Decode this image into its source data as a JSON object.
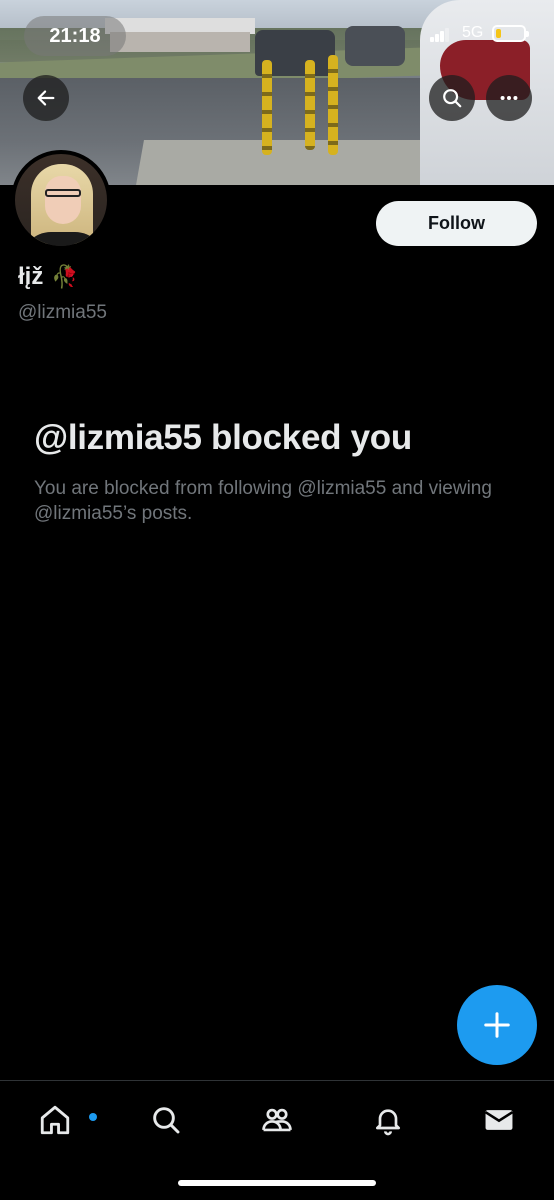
{
  "status_bar": {
    "time": "21:18",
    "network": "5G",
    "battery_level": 0.2,
    "battery_color": "#f5c518"
  },
  "header": {
    "back_icon": "arrow-left-icon",
    "search_icon": "search-icon",
    "more_icon": "more-horizontal-icon"
  },
  "profile": {
    "display_name": "łįž",
    "name_emoji": "🥀",
    "handle": "@lizmia55",
    "follow_label": "Follow"
  },
  "blocked": {
    "title": "@lizmia55 blocked you",
    "description": "You are blocked from following @lizmia55 and viewing @lizmia55’s posts."
  },
  "fab": {
    "icon": "plus-icon",
    "color": "#1d9bf0"
  },
  "tabbar": {
    "items": [
      {
        "icon": "home-icon",
        "has_notification_dot": true
      },
      {
        "icon": "search-icon"
      },
      {
        "icon": "communities-icon"
      },
      {
        "icon": "bell-icon"
      },
      {
        "icon": "mail-icon"
      }
    ],
    "accent": "#1d9bf0"
  }
}
